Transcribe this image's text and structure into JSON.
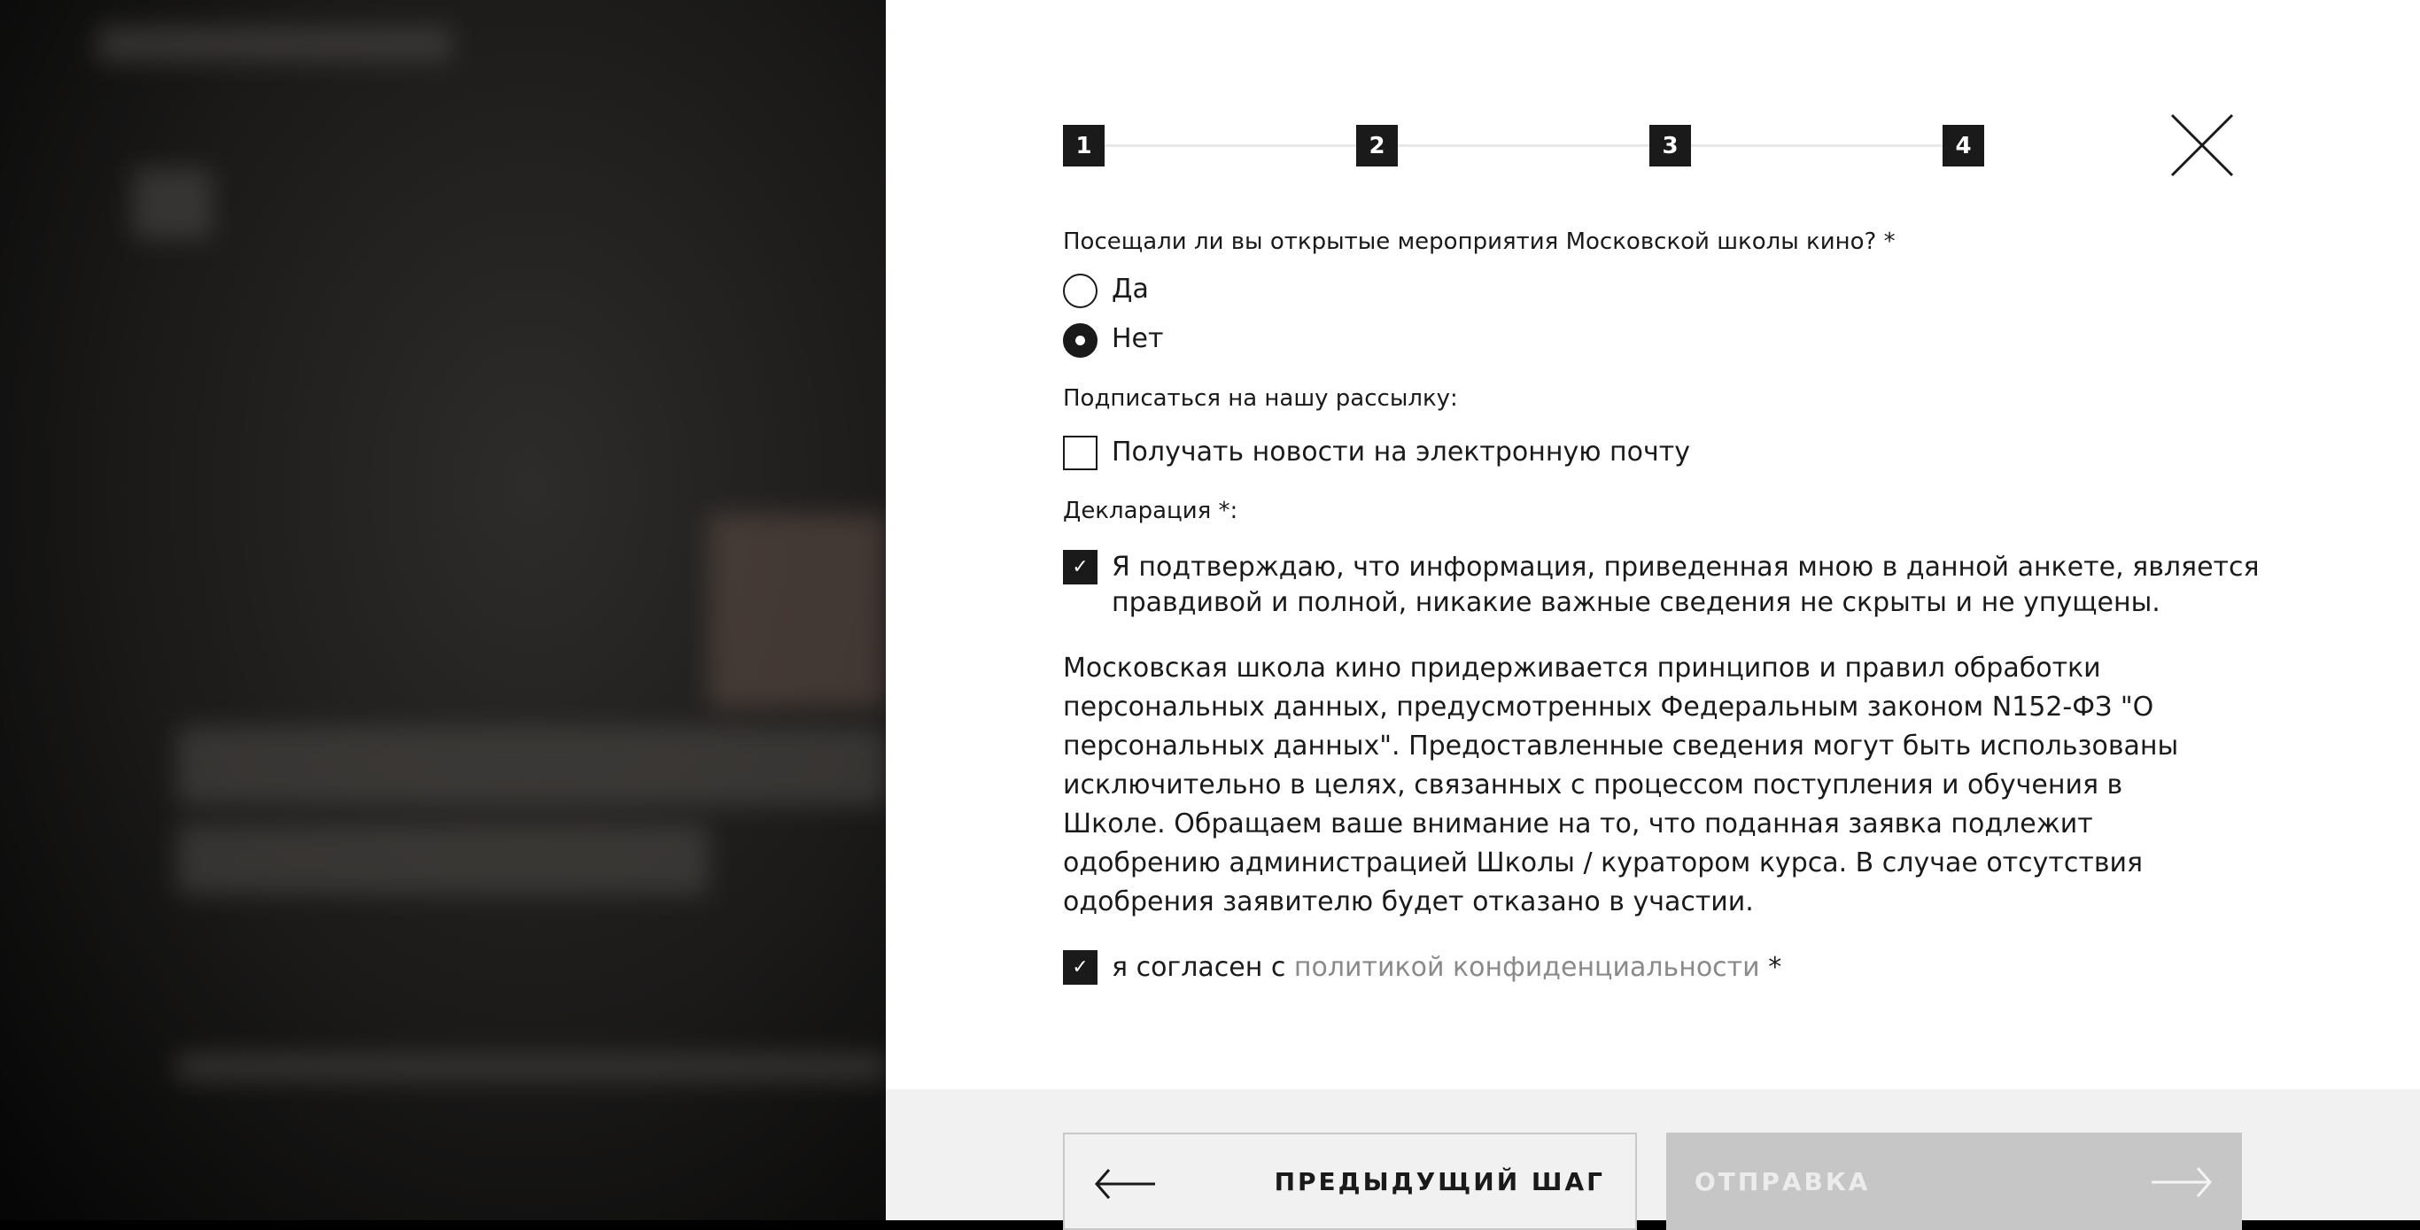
{
  "steps": [
    "1",
    "2",
    "3",
    "4"
  ],
  "question": "Посещали ли вы открытые мероприятия Московской школы кино? *",
  "options": [
    {
      "label": "Да",
      "selected": false
    },
    {
      "label": "Нет",
      "selected": true
    }
  ],
  "subscribe_label": "Подписаться на нашу рассылку:",
  "subscribe_option": "Получать новости на электронную почту",
  "declaration_label": "Декларация *:",
  "declaration_line1": "Я подтверждаю, что информация, приведенная мною в данной анкете, является",
  "declaration_line2": "правдивой и полной, никакие важные сведения не скрыты и не упущены.",
  "policy_text": "Московская школа кино придерживается принципов и правил обработки персональных данных, предусмотренных Федеральным законом N152-ФЗ \"О персональных данных\". Предоставленные сведения могут быть использованы исключительно в целях, связанных с процессом поступления и обучения в Школе. Обращаем ваше внимание на то, что поданная заявка подлежит одобрению администрацией Школы / куратором курса. В случае отсутствия одобрения заявителю будет отказано в участии.",
  "agree_prefix": "я согласен с ",
  "agree_link": "политикой конфиденциальности",
  "agree_suffix": " *",
  "prev_button": "ПРЕДЫДУЩИЙ ШАГ",
  "send_button": "ОТПРАВКА"
}
